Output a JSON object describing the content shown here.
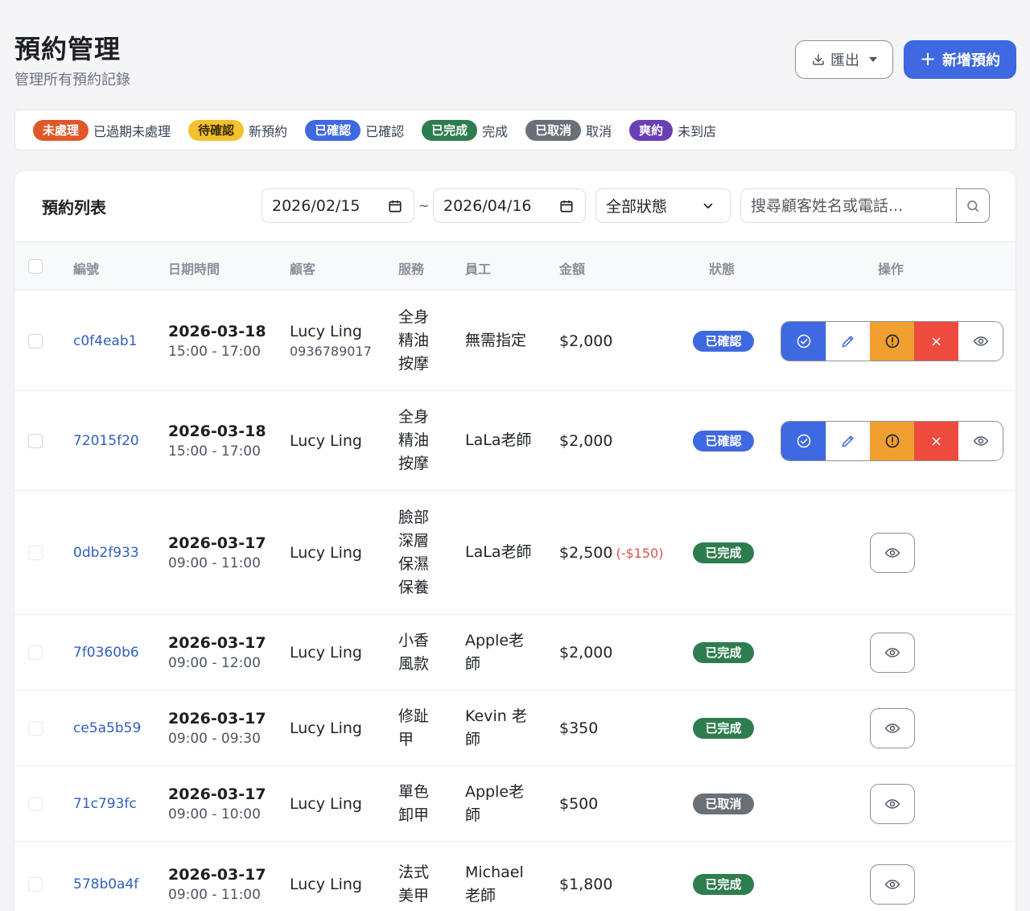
{
  "header": {
    "title": "預約管理",
    "subtitle": "管理所有預約記錄",
    "export_label": "匯出",
    "new_label": "新增預約"
  },
  "legend": [
    {
      "badge": "未處理",
      "text": "已過期未處理",
      "color": "#e0582a"
    },
    {
      "badge": "待確認",
      "text": "新預約",
      "color": "#f2c12e"
    },
    {
      "badge": "已確認",
      "text": "已確認",
      "color": "#3e69e0"
    },
    {
      "badge": "已完成",
      "text": "完成",
      "color": "#2e7d4f"
    },
    {
      "badge": "已取消",
      "text": "取消",
      "color": "#6b7078"
    },
    {
      "badge": "爽約",
      "text": "未到店",
      "color": "#6a3fb5"
    }
  ],
  "list": {
    "title": "預約列表",
    "date_from": "2026/02/15",
    "date_separator": "~",
    "date_to": "2026/04/16",
    "status_filter": "全部狀態",
    "search_placeholder": "搜尋顧客姓名或電話..."
  },
  "columns": [
    "編號",
    "日期時間",
    "顧客",
    "服務",
    "員工",
    "金額",
    "狀態",
    "操作"
  ],
  "rows": [
    {
      "id": "c0f4eab1",
      "date": "2026-03-18",
      "time": "15:00 - 17:00",
      "customer": "Lucy Ling",
      "phone": "0936789017",
      "service": "全身精油按摩",
      "staff": "無需指定",
      "amount": "$2,000",
      "discount": "",
      "status": "已確認",
      "status_color": "#3e69e0",
      "actions": "full"
    },
    {
      "id": "72015f20",
      "date": "2026-03-18",
      "time": "15:00 - 17:00",
      "customer": "Lucy Ling",
      "phone": "",
      "service": "全身精油按摩",
      "staff": "LaLa老師",
      "amount": "$2,000",
      "discount": "",
      "status": "已確認",
      "status_color": "#3e69e0",
      "actions": "full"
    },
    {
      "id": "0db2f933",
      "date": "2026-03-17",
      "time": "09:00 - 11:00",
      "customer": "Lucy Ling",
      "phone": "",
      "service": "臉部深層保濕保養",
      "staff": "LaLa老師",
      "amount": "$2,500",
      "discount": "(-$150)",
      "status": "已完成",
      "status_color": "#2e7d4f",
      "actions": "view"
    },
    {
      "id": "7f0360b6",
      "date": "2026-03-17",
      "time": "09:00 - 12:00",
      "customer": "Lucy Ling",
      "phone": "",
      "service": "小香風款",
      "staff": "Apple老師",
      "amount": "$2,000",
      "discount": "",
      "status": "已完成",
      "status_color": "#2e7d4f",
      "actions": "view"
    },
    {
      "id": "ce5a5b59",
      "date": "2026-03-17",
      "time": "09:00 - 09:30",
      "customer": "Lucy Ling",
      "phone": "",
      "service": "修趾甲",
      "staff": "Kevin 老師",
      "amount": "$350",
      "discount": "",
      "status": "已完成",
      "status_color": "#2e7d4f",
      "actions": "view"
    },
    {
      "id": "71c793fc",
      "date": "2026-03-17",
      "time": "09:00 - 10:00",
      "customer": "Lucy Ling",
      "phone": "",
      "service": "單色卸甲",
      "staff": "Apple老師",
      "amount": "$500",
      "discount": "",
      "status": "已取消",
      "status_color": "#6b7078",
      "actions": "view"
    },
    {
      "id": "578b0a4f",
      "date": "2026-03-17",
      "time": "09:00 - 11:00",
      "customer": "Lucy Ling",
      "phone": "",
      "service": "法式美甲",
      "staff": "Michael老師",
      "amount": "$1,800",
      "discount": "",
      "status": "已完成",
      "status_color": "#2e7d4f",
      "actions": "view"
    }
  ],
  "icons": {
    "export": "download-icon",
    "new": "plus-icon",
    "date": "calendar-icon",
    "select": "chevron-down-icon",
    "search": "search-icon",
    "confirm": "check-circle-icon",
    "edit": "pencil-icon",
    "noshow": "alert-circle-icon",
    "cancel": "close-icon",
    "view": "eye-icon"
  }
}
